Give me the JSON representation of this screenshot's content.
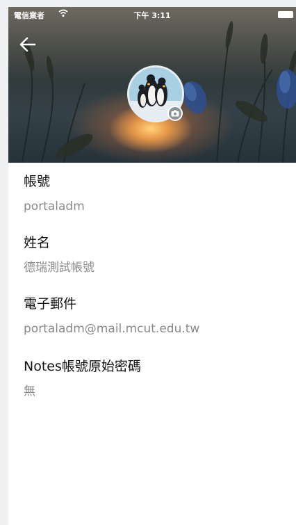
{
  "status_bar": {
    "carrier": "電信業者",
    "time": "下午 3:11"
  },
  "header": {
    "back_icon": "arrow-left-icon",
    "camera_icon": "camera-icon",
    "avatar_description_icon": "penguins-avatar"
  },
  "profile": {
    "fields": [
      {
        "label": "帳號",
        "value": "portaladm"
      },
      {
        "label": "姓名",
        "value": "德瑞測試帳號"
      },
      {
        "label": "電子郵件",
        "value": "portaladm@mail.mcut.edu.tw"
      },
      {
        "label": "Notes帳號原始密碼",
        "value": "無"
      }
    ]
  }
}
